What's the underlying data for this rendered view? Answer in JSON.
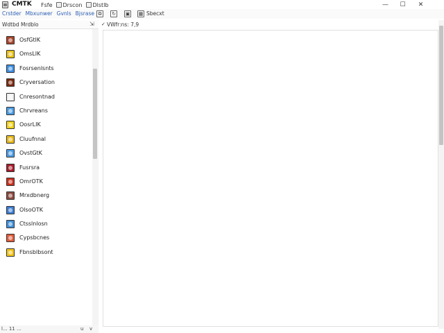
{
  "window": {
    "title": "CMTK",
    "minimize": "—",
    "maximize": "☐",
    "close": "✕"
  },
  "menu": [
    {
      "label": "Fsfe",
      "icon": "file-icon"
    },
    {
      "label": "Drscon",
      "icon": "settings-icon"
    },
    {
      "label": "Dlstlb",
      "icon": "list-icon"
    }
  ],
  "toolbar": {
    "links": [
      "Crstder",
      "Mbxunwer",
      "Gvnls",
      "Bjsrase"
    ],
    "tool_label": "Sbecxt"
  },
  "left_pane": {
    "header": "Wdtbd Mrdblo",
    "pin": "⇲",
    "items": [
      {
        "label": "OsfGtlK",
        "icon": "shield-icon",
        "color": "#a8432c"
      },
      {
        "label": "OmsLIK",
        "icon": "warning-icon",
        "color": "#e9c11a"
      },
      {
        "label": "Fosrsenlsnts",
        "icon": "document-icon",
        "color": "#3d8fe0"
      },
      {
        "label": "Cryversation",
        "icon": "chat-icon",
        "color": "#7a2a10"
      },
      {
        "label": "Cnresontnad",
        "icon": "clock-icon",
        "color": "#f2f2f2"
      },
      {
        "label": "Chrvreans",
        "icon": "folder-icon",
        "color": "#4a9be3"
      },
      {
        "label": "OosrLIK",
        "icon": "star-icon",
        "color": "#f2d21a"
      },
      {
        "label": "Cluufnnal",
        "icon": "bolt-icon",
        "color": "#e8b91c"
      },
      {
        "label": "OvstGtK",
        "icon": "box-icon",
        "color": "#4a9be3"
      },
      {
        "label": "Fusrsra",
        "icon": "book-icon",
        "color": "#a61d2a"
      },
      {
        "label": "OmrOTK",
        "icon": "flag-icon",
        "color": "#c8301e"
      },
      {
        "label": "Mrxdbnerg",
        "icon": "user-icon",
        "color": "#8a4a3e"
      },
      {
        "label": "OlsoOTK",
        "icon": "grid-icon",
        "color": "#3d7dd0"
      },
      {
        "label": "Ctsslnlosn",
        "icon": "calendar-icon",
        "color": "#3f8ed8"
      },
      {
        "label": "Cypsbcnes",
        "icon": "heart-icon",
        "color": "#e05c3a"
      },
      {
        "label": "Fbnsblbsont",
        "icon": "palette-icon",
        "color": "#f2c418"
      }
    ]
  },
  "status_left": "l... 11 ... ",
  "status_right1": "u",
  "status_right2": "v",
  "right_pane": {
    "arrow": "✓",
    "header": "VWfr:ns: 7,9"
  }
}
